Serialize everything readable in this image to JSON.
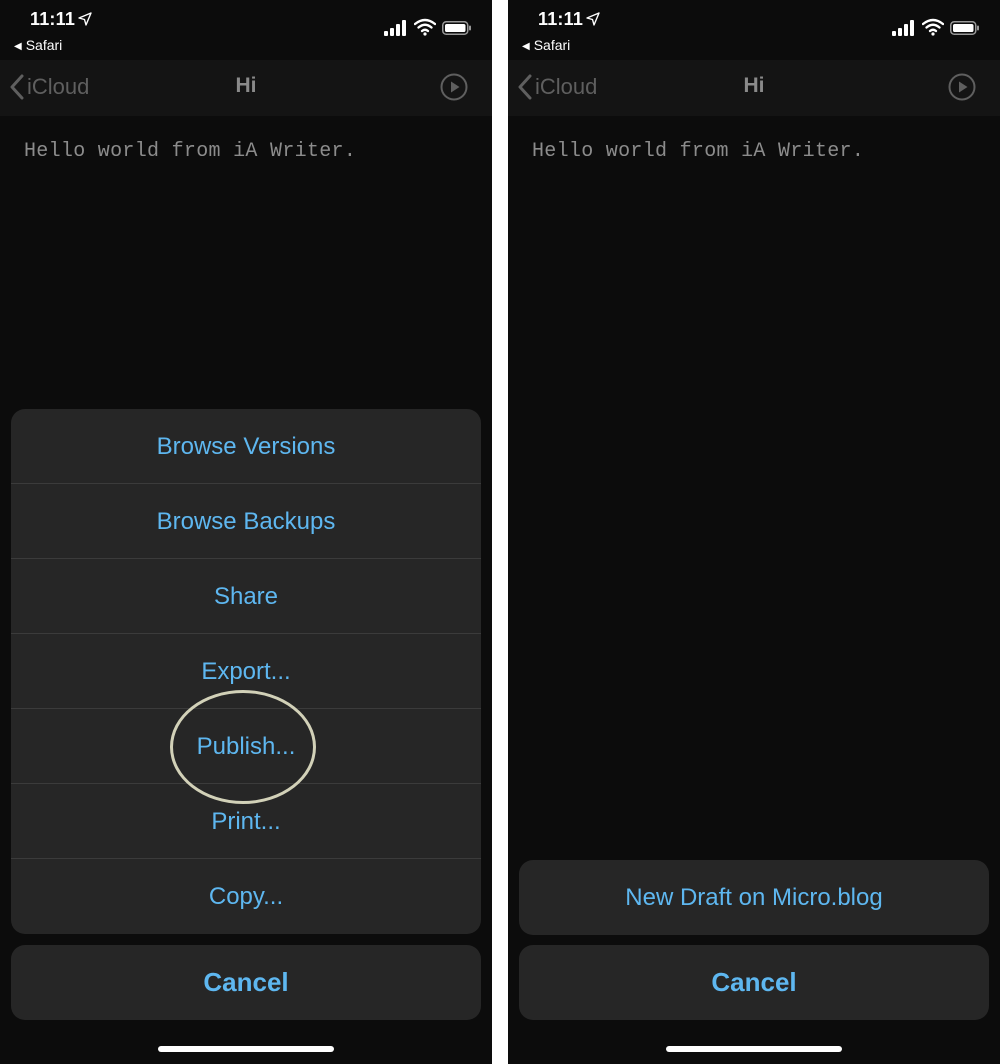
{
  "status_bar": {
    "time": "11:11",
    "back_app": "Safari"
  },
  "nav": {
    "back_label": "iCloud",
    "title": "Hi"
  },
  "editor": {
    "text": "Hello world from iA Writer."
  },
  "left_sheet": {
    "items": [
      "Browse Versions",
      "Browse Backups",
      "Share",
      "Export...",
      "Publish...",
      "Print...",
      "Copy..."
    ],
    "cancel": "Cancel"
  },
  "right_sheet": {
    "items": [
      "New Draft on Micro.blog"
    ],
    "cancel": "Cancel"
  },
  "colors": {
    "accent": "#5eb7f0",
    "sheet_bg": "#262626",
    "background": "#0c0c0c",
    "highlight_circle": "#d2d1b8"
  },
  "icons": [
    "location-arrow-icon",
    "signal-icon",
    "wifi-icon",
    "battery-icon",
    "chevron-left-icon",
    "play-circle-icon"
  ]
}
